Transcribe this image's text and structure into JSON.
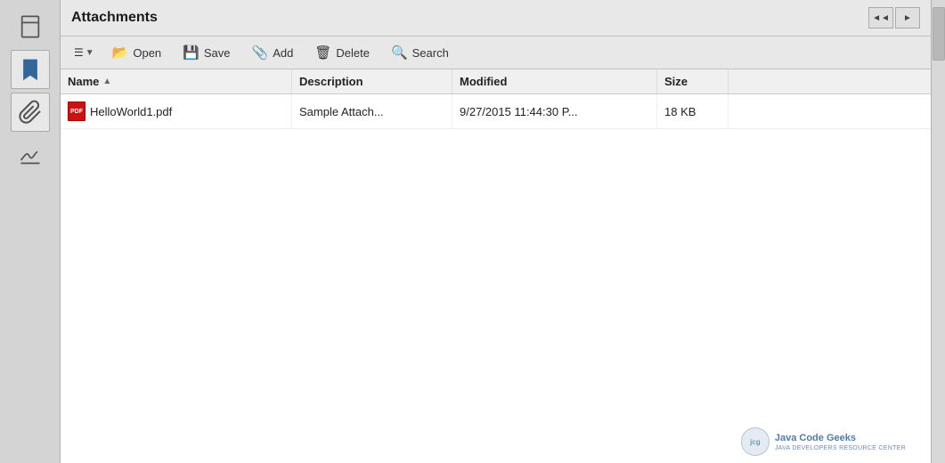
{
  "sidebar": {
    "icons": [
      {
        "name": "page-icon",
        "label": "Page"
      },
      {
        "name": "bookmark-icon",
        "label": "Bookmarks"
      },
      {
        "name": "attachment-icon",
        "label": "Attachments"
      },
      {
        "name": "signature-icon",
        "label": "Signatures"
      }
    ]
  },
  "header": {
    "title": "Attachments",
    "nav_back_label": "◄◄",
    "nav_forward_label": "►"
  },
  "toolbar": {
    "list_icon": "☰",
    "dropdown_arrow": "▼",
    "open_label": "Open",
    "save_label": "Save",
    "add_label": "Add",
    "delete_label": "Delete",
    "search_label": "Search"
  },
  "file_list": {
    "columns": [
      {
        "id": "name",
        "label": "Name",
        "sort": true
      },
      {
        "id": "description",
        "label": "Description",
        "sort": false
      },
      {
        "id": "modified",
        "label": "Modified",
        "sort": false
      },
      {
        "id": "size",
        "label": "Size",
        "sort": false
      }
    ],
    "rows": [
      {
        "name": "HelloWorld1.pdf",
        "description": "Sample Attach...",
        "modified": "9/27/2015 11:44:30 P...",
        "size": "18 KB"
      }
    ]
  },
  "branding": {
    "logo_text": "jcg",
    "company": "Java Code Geeks",
    "tagline": "JAVA DEVELOPERS RESOURCE CENTER"
  }
}
